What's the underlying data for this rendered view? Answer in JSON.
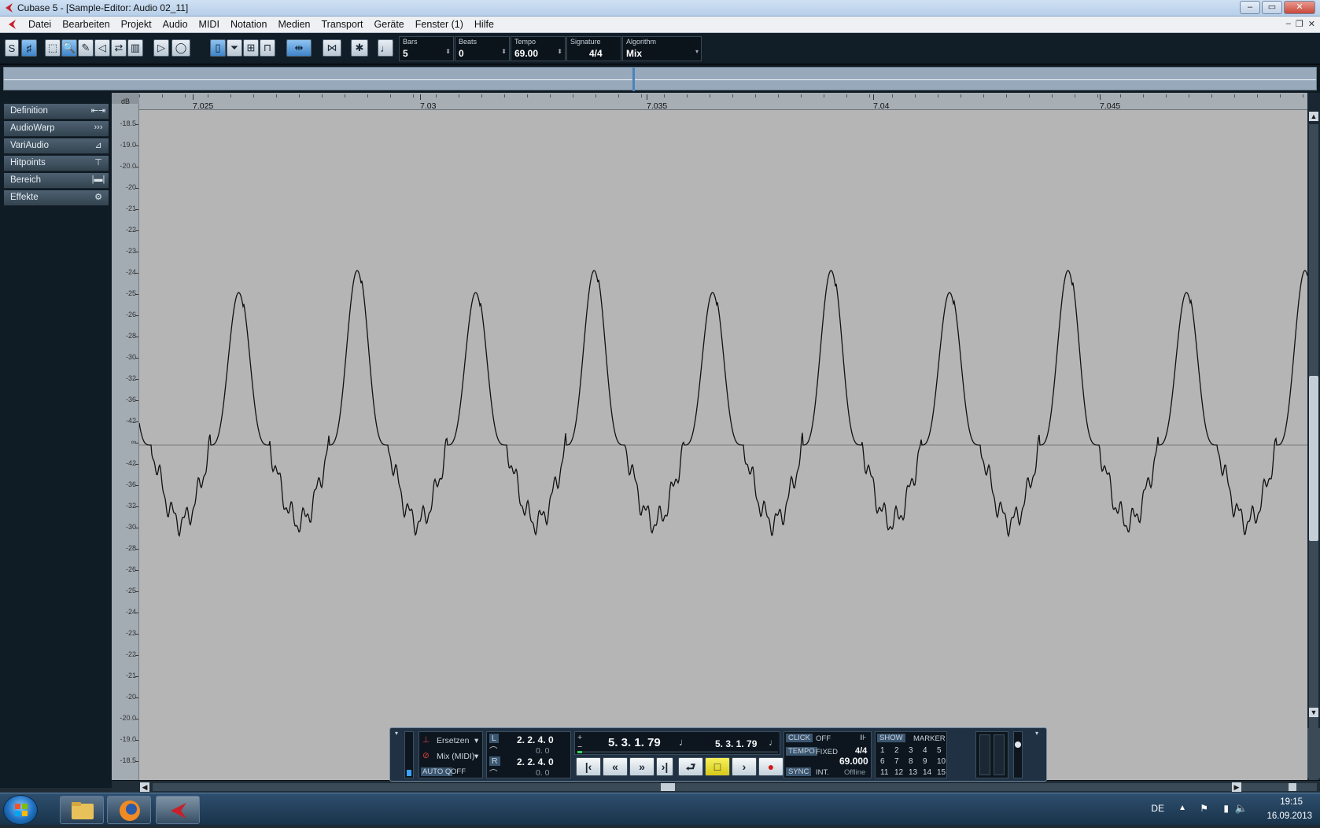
{
  "window": {
    "title": "Cubase 5 - [Sample-Editor: Audio 02_11]",
    "controls": {
      "minimize": "–",
      "maximize": "▭",
      "close": "✕"
    },
    "mdi_controls": {
      "minimize": "–",
      "restore": "❐",
      "close": "✕"
    }
  },
  "menu": {
    "items": [
      "Datei",
      "Bearbeiten",
      "Projekt",
      "Audio",
      "MIDI",
      "Notation",
      "Medien",
      "Transport",
      "Geräte",
      "Fenster (1)",
      "Hilfe"
    ]
  },
  "toolbar": {
    "fields": {
      "bars": {
        "label": "Bars",
        "value": "5"
      },
      "beats": {
        "label": "Beats",
        "value": "0"
      },
      "tempo": {
        "label": "Tempo",
        "value": "69.00"
      },
      "signature": {
        "label": "Signature",
        "value": "4/4"
      },
      "algorithm": {
        "label": "Algorithm",
        "value": "Mix"
      }
    }
  },
  "inspector": {
    "items": [
      {
        "label": "Definition",
        "icon": "definition-icon",
        "glyph": "⇤⇥"
      },
      {
        "label": "AudioWarp",
        "icon": "audiowarp-icon",
        "glyph": "›››"
      },
      {
        "label": "VariAudio",
        "icon": "variaudio-icon",
        "glyph": "⊿"
      },
      {
        "label": "Hitpoints",
        "icon": "hitpoints-icon",
        "glyph": "⊤"
      },
      {
        "label": "Bereich",
        "icon": "range-icon",
        "glyph": "|▬|"
      },
      {
        "label": "Effekte",
        "icon": "gear-icon",
        "glyph": "⚙"
      }
    ]
  },
  "ruler": {
    "unit_label": "dB",
    "ticks": [
      "7.025",
      "7.03",
      "7.035",
      "7.04",
      "7.045"
    ]
  },
  "db_scale": {
    "labels": [
      "-18.5",
      "-19.0",
      "-20.0",
      "-20",
      "-21",
      "-22",
      "-23",
      "-24",
      "-25",
      "-26",
      "-28",
      "-30",
      "-32",
      "-36",
      "-42",
      "∞",
      "-42",
      "-36",
      "-32",
      "-30",
      "-28",
      "-26",
      "-25",
      "-24",
      "-23",
      "-22",
      "-21",
      "-20",
      "-20.0",
      "-19.0",
      "-18.5"
    ]
  },
  "transport": {
    "mode_top": "Ersetzen",
    "mode_bottom": "Mix (MIDI)",
    "auto_q": "AUTO Q",
    "auto_q_value": "OFF",
    "left_locator": "2. 2. 4.   0",
    "left_locator_sub": "0.   0",
    "right_locator": "2. 2. 4.   0",
    "right_locator_sub": "0.   0",
    "position_primary": "5. 3. 1. 79",
    "position_secondary": "5. 3. 1. 79",
    "click_label": "CLICK",
    "click_value": "OFF",
    "tempo_label": "TEMPO",
    "tempo_mode": "FIXED",
    "signature": "4/4",
    "tempo_value": "69.000",
    "sync_label": "SYNC",
    "sync_mode": "INT.",
    "sync_status": "Offline",
    "show_label": "SHOW",
    "marker_label": "MARKER",
    "markers_row1": [
      "1",
      "2",
      "3",
      "4",
      "5"
    ],
    "markers_row2": [
      "6",
      "7",
      "8",
      "9",
      "10"
    ],
    "markers_row3": [
      "11",
      "12",
      "13",
      "14",
      "15"
    ]
  },
  "taskbar": {
    "language": "DE",
    "time": "19:15",
    "date": "16.09.2013"
  },
  "colors": {
    "waveform_bg": "#b5b5b5",
    "waveform_line": "#111111",
    "zero_line": "#7a7a7a",
    "dark_panel": "#111d27",
    "accent_blue": "#4b83be",
    "stop_yellow": "#e6d932",
    "record_red": "#d21818"
  }
}
